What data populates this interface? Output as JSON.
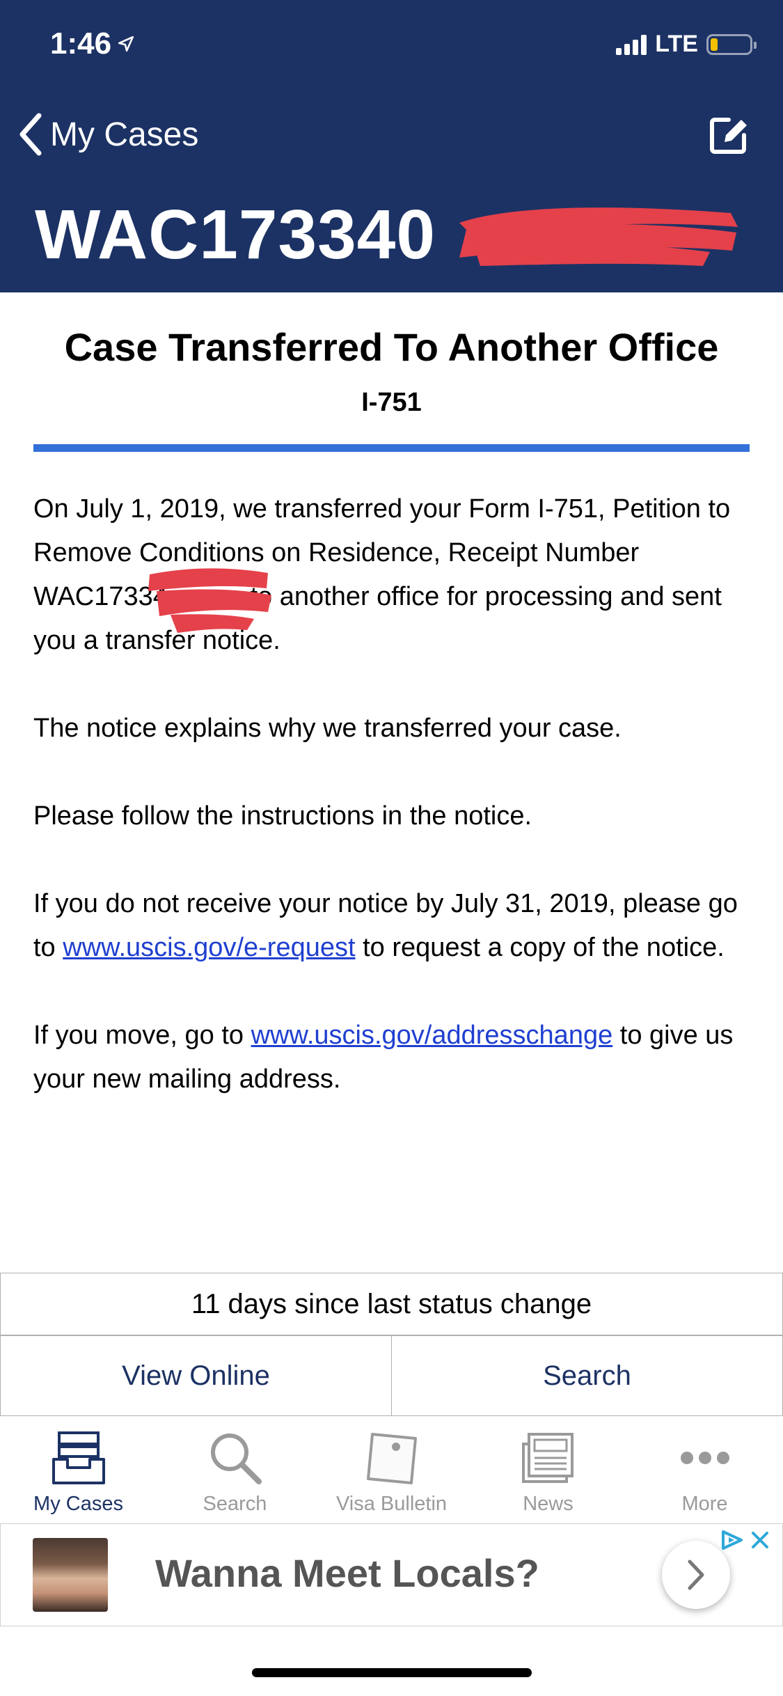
{
  "status_bar": {
    "time": "1:46",
    "network": "LTE"
  },
  "nav": {
    "back_label": "My Cases",
    "receipt_number": "WAC173340"
  },
  "case": {
    "status_title": "Case Transferred To Another Office",
    "form_type": "I-751",
    "paragraph1": {
      "before": "On July 1, 2019, we transferred your Form I-751, Petition to Remove Conditions on Residence, Receipt Number ",
      "receipt_partial": "WAC17334",
      "after": " to another office for processing and sent you a transfer notice."
    },
    "paragraph2": "The notice explains why we transferred your case.",
    "paragraph3": "Please follow the instructions in the notice.",
    "paragraph4": {
      "before": "If you do not receive your notice by July 31, 2019, please go to ",
      "link": "www.uscis.gov/e-request",
      "after": " to request a copy of the notice."
    },
    "paragraph5": {
      "before": "If you move, go to ",
      "link": "www.uscis.gov/addresschange",
      "after": " to give us your new mailing address."
    }
  },
  "days_since_change": "11 days since last status change",
  "actions": {
    "view_online": "View Online",
    "search": "Search"
  },
  "tabs": [
    {
      "label": "My Cases",
      "icon": "inbox-tray-icon"
    },
    {
      "label": "Search",
      "icon": "magnifier-icon"
    },
    {
      "label": "Visa Bulletin",
      "icon": "pinned-note-icon"
    },
    {
      "label": "News",
      "icon": "newspaper-icon"
    },
    {
      "label": "More",
      "icon": "more-dots-icon"
    }
  ],
  "ad": {
    "headline": "Wanna Meet Locals?"
  },
  "colors": {
    "header_bg": "#1c3264",
    "accent_blue": "#3370d8",
    "redaction": "#e5414b"
  }
}
